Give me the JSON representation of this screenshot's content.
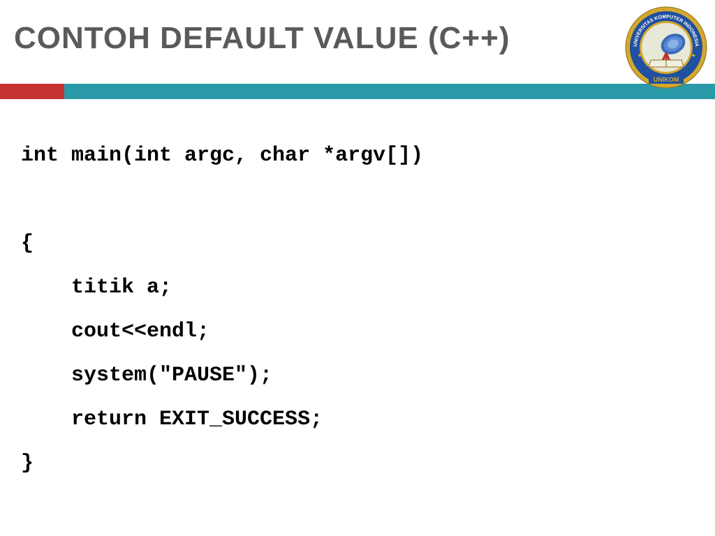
{
  "slide": {
    "title": "CONTOH DEFAULT VALUE (C++)",
    "code": {
      "line1": "int main(int argc, char *argv[])",
      "line2": "{",
      "line3": "    titik a;",
      "line4": "    cout<<endl;",
      "line5": "    system(\"PAUSE\");",
      "line6": "    return EXIT_SUCCESS;",
      "line7": "}"
    },
    "logo": {
      "text_top": "UNIVERSITAS KOMPUTER INDONESIA",
      "text_bottom": "UNIKOM"
    },
    "colors": {
      "title": "#5a5a5a",
      "red_accent": "#c83232",
      "teal_accent": "#2a99a8"
    }
  }
}
